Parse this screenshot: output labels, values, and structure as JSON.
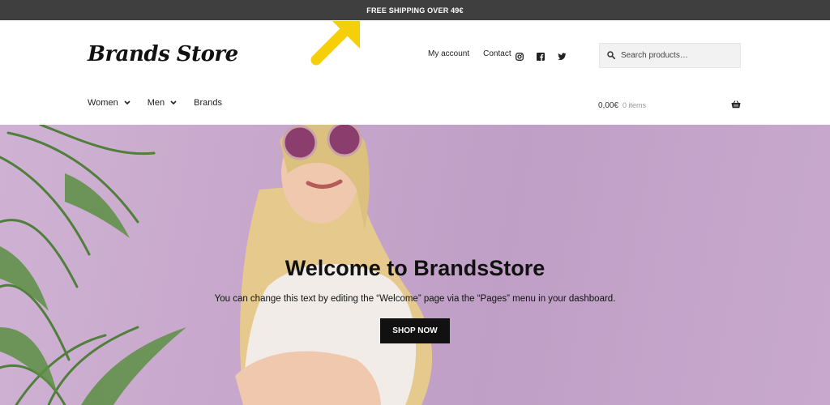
{
  "topbar": {
    "message": "FREE SHIPPING OVER 49€"
  },
  "header": {
    "logo": "Brands Store",
    "secondary_nav": [
      "My account",
      "Contact"
    ],
    "social_icons": [
      "instagram-icon",
      "facebook-icon",
      "twitter-icon"
    ],
    "search": {
      "placeholder": "Search products…"
    }
  },
  "nav": {
    "items": [
      {
        "label": "Women",
        "has_dropdown": true
      },
      {
        "label": "Men",
        "has_dropdown": true
      },
      {
        "label": "Brands",
        "has_dropdown": false
      }
    ]
  },
  "cart": {
    "total": "0,00€",
    "count": "0 items"
  },
  "hero": {
    "title": "Welcome to BrandsStore",
    "text": "You can change this text by editing the “Welcome” page via the “Pages” menu in your dashboard.",
    "button": "SHOP NOW"
  },
  "colors": {
    "topbar": "#3f3f3f",
    "hero_bg": "#c6a6cb",
    "button": "#111111",
    "annotation_arrow": "#f5cf0a"
  }
}
